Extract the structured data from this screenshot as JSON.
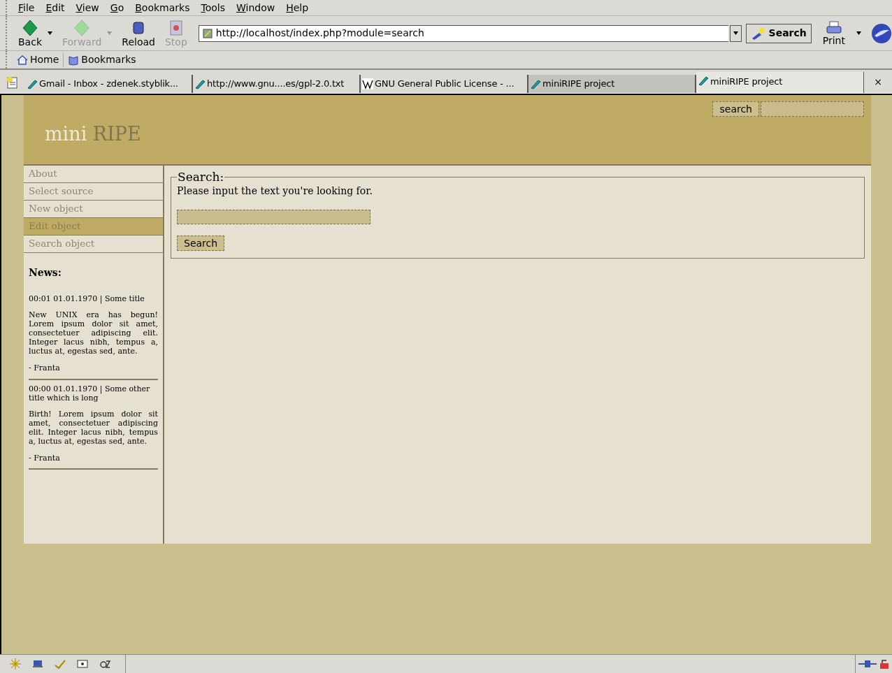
{
  "menu": [
    {
      "label": "File"
    },
    {
      "label": "Edit"
    },
    {
      "label": "View"
    },
    {
      "label": "Go"
    },
    {
      "label": "Bookmarks"
    },
    {
      "label": "Tools"
    },
    {
      "label": "Window"
    },
    {
      "label": "Help"
    }
  ],
  "toolbar": {
    "buttons": [
      {
        "kind": "back",
        "label": "Back",
        "disabled": false,
        "dropdown": true
      },
      {
        "kind": "forward",
        "label": "Forward",
        "disabled": true,
        "dropdown": true
      },
      {
        "kind": "reload",
        "label": "Reload",
        "disabled": false,
        "dropdown": false
      },
      {
        "kind": "stop",
        "label": "Stop",
        "disabled": true,
        "dropdown": false
      }
    ],
    "address": "http://localhost/index.php?module=search",
    "search_button": "Search",
    "print_button": "Print"
  },
  "personal_toolbar": [
    {
      "kind": "home",
      "label": "Home"
    },
    {
      "kind": "bookmarks",
      "label": "Bookmarks"
    }
  ],
  "tabs": [
    {
      "kind": "page",
      "label": "Gmail - Inbox - zdenek.styblik...",
      "selected": false,
      "hovered": false
    },
    {
      "kind": "page",
      "label": "http://www.gnu....es/gpl-2.0.txt",
      "selected": false,
      "hovered": false
    },
    {
      "kind": "wiki",
      "label": "GNU General Public License - ...",
      "selected": false,
      "hovered": false
    },
    {
      "kind": "page",
      "label": "miniRIPE project",
      "selected": false,
      "hovered": true
    },
    {
      "kind": "page",
      "label": "miniRIPE project",
      "selected": true,
      "hovered": false
    }
  ],
  "close_tab": "×",
  "site": {
    "logo_first": "mini",
    "logo_second": "RIPE",
    "header_search_button": "search",
    "nav": [
      {
        "label": "About",
        "selected": false
      },
      {
        "label": "Select source",
        "selected": false
      },
      {
        "label": "New object",
        "selected": false
      },
      {
        "label": "Edit object",
        "selected": true
      },
      {
        "label": "Search object",
        "selected": false
      }
    ],
    "news": {
      "heading": "News:",
      "items": [
        {
          "meta": "00:01 01.01.1970 | Some title",
          "body": "New UNIX era has begun! Lorem ipsum dolor sit amet, consectetuer adipiscing elit. Integer lacus nibh, tempus a, luctus at, egestas sed, ante.",
          "author": "- Franta"
        },
        {
          "meta": "00:00 01.01.1970 | Some other title which is long",
          "body": "Birth! Lorem ipsum dolor sit amet, consectetuer adipiscing elit. Integer lacus nibh, tempus a, luctus at, egestas sed, ante.",
          "author": "- Franta"
        }
      ]
    },
    "search_form": {
      "legend": "Search:",
      "prompt": "Please input the text you're looking for.",
      "button": "Search"
    }
  }
}
